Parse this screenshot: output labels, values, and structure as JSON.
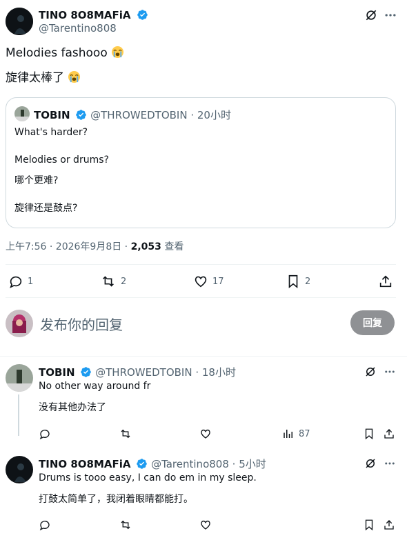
{
  "main_tweet": {
    "author_name": "TINO 8O8MAFiA",
    "author_handle": "@Tarentino808",
    "text_line1": "Melodies fashooo",
    "text_line2": "旋律太棒了",
    "quote": {
      "author_name": "TOBIN",
      "author_handle": "@THROWEDTOBIN",
      "time": "· 20小时",
      "line1": "What's harder?",
      "line2": "Melodies or drums?",
      "line3": "哪个更难?",
      "line4": "旋律还是鼓点?"
    },
    "timestamp": "上午7:56 · 2026年9月8日 · ",
    "views_count": "2,053",
    "views_label": " 查看",
    "metrics": {
      "replies": "1",
      "reposts": "2",
      "likes": "17",
      "bookmarks": "2"
    }
  },
  "reply_box": {
    "placeholder": "发布你的回复",
    "button_label": "回复"
  },
  "replies": [
    {
      "author_name": "TOBIN",
      "author_handle": "@THROWEDTOBIN",
      "time": "· 18小时",
      "line1": "No other way around fr",
      "line2": "没有其他办法了",
      "views": "87"
    },
    {
      "author_name": "TINO 8O8MAFiA",
      "author_handle": "@Tarentino808",
      "time": "· 5小时",
      "line1": "Drums is tooo easy, I can do em in my sleep.",
      "line2": "打鼓太简单了，我闭着眼睛都能打。"
    }
  ],
  "colors": {
    "verified": "#1d9bf0",
    "text": "#0f1419",
    "secondary": "#536471",
    "reply_button_bg": "#8f9194"
  }
}
